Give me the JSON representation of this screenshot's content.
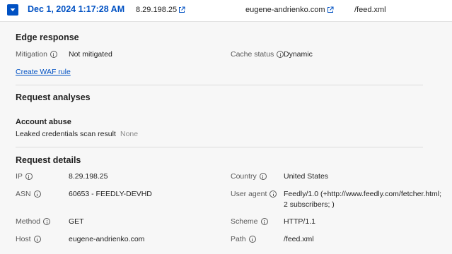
{
  "header": {
    "timestamp": "Dec 1, 2024 1:17:28 AM",
    "ip": "8.29.198.25",
    "host": "eugene-andrienko.com",
    "path": "/feed.xml"
  },
  "edge_response": {
    "title": "Edge response",
    "mitigation_label": "Mitigation",
    "mitigation_value": "Not mitigated",
    "cache_status_label": "Cache status",
    "cache_status_value": "Dynamic",
    "create_waf_rule": "Create WAF rule"
  },
  "request_analyses": {
    "title": "Request analyses",
    "subsection_title": "Account abuse",
    "leaked_label": "Leaked credentials scan result",
    "leaked_value": "None"
  },
  "request_details": {
    "title": "Request details",
    "ip_label": "IP",
    "ip_value": "8.29.198.25",
    "country_label": "Country",
    "country_value": "United States",
    "asn_label": "ASN",
    "asn_value": "60653 - FEEDLY-DEVHD",
    "user_agent_label": "User agent",
    "user_agent_value": "Feedly/1.0 (+http://www.feedly.com/fetcher.html; 2 subscribers; )",
    "method_label": "Method",
    "method_value": "GET",
    "scheme_label": "Scheme",
    "scheme_value": "HTTP/1.1",
    "host_label": "Host",
    "host_value": "eugene-andrienko.com",
    "path_label": "Path",
    "path_value": "/feed.xml"
  },
  "icons": {
    "collapse": "chevron-down-icon",
    "external": "external-link-icon",
    "info": "info-icon"
  },
  "colors": {
    "accent": "#0051c3",
    "panel_bg": "#f7f7f7"
  }
}
